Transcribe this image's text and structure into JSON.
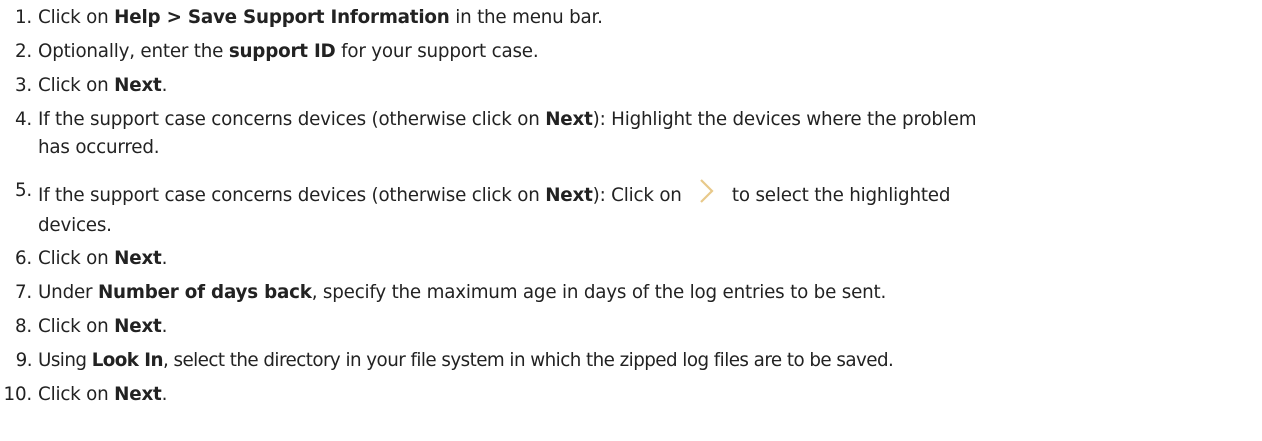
{
  "steps": [
    {
      "num": "1.",
      "parts": [
        "Click on ",
        "Help > Save Support Information",
        " in the menu bar."
      ]
    },
    {
      "num": "2.",
      "parts": [
        "Optionally, enter the ",
        "support ID",
        " for your support case."
      ]
    },
    {
      "num": "3.",
      "parts": [
        "Click on ",
        "Next",
        "."
      ]
    },
    {
      "num": "4.",
      "parts": [
        "If the support case concerns devices (otherwise click on ",
        "Next",
        "): Highlight the devices where the problem has occurred."
      ]
    },
    {
      "num": "5.",
      "parts": [
        "If the support case concerns devices (otherwise click on ",
        "Next",
        "): Click on ",
        " to select the highlighted devices."
      ]
    },
    {
      "num": "6.",
      "parts": [
        "Click on ",
        "Next",
        "."
      ]
    },
    {
      "num": "7.",
      "parts": [
        "Under ",
        "Number of days back",
        ", specify the maximum age in days of the log entries to be sent."
      ]
    },
    {
      "num": "8.",
      "parts": [
        "Click on ",
        "Next",
        "."
      ]
    },
    {
      "num": "9.",
      "parts": [
        "Using ",
        "Look In",
        ", select the directory in your file system in which the zipped log files are to be saved."
      ]
    },
    {
      "num": "10.",
      "parts": [
        "Click on ",
        "Next",
        "."
      ]
    }
  ],
  "icons": {
    "select_arrow": "chevron-right-icon",
    "select_arrow_color": "#e8c98a"
  }
}
